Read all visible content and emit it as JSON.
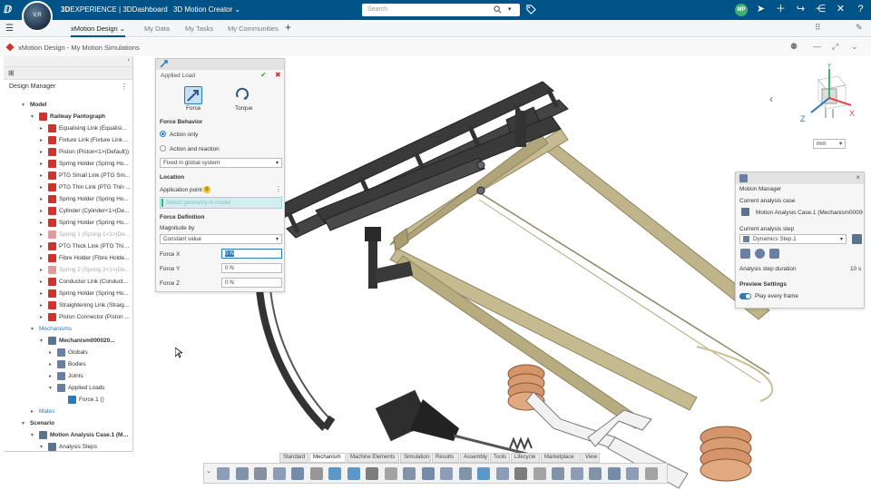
{
  "topbar": {
    "brand": "3DEXPERIENCE | 3DDashboard",
    "brand_prefix": "3D",
    "brand_rest": "EXPERIENCE | 3DDashboard",
    "app_name": "3D Motion Creator",
    "compass_text": "V,R",
    "search_placeholder": "Search",
    "user_initials": "MP"
  },
  "tabbar": {
    "tabs": [
      {
        "label": "xMotion Design"
      },
      {
        "label": "My Data"
      },
      {
        "label": "My Tasks"
      },
      {
        "label": "My Communities"
      }
    ],
    "add_tab": "+"
  },
  "breadcrumb": {
    "text": "xMotion Design - My Motion Simulations"
  },
  "design_manager": {
    "title": "Design Manager",
    "tree": [
      {
        "label": "Model",
        "level": 0,
        "style": "bold",
        "arrow": "▾"
      },
      {
        "label": "Railway Pantograph",
        "level": 1,
        "style": "bold",
        "arrow": "▾",
        "color": "#d4312d"
      },
      {
        "label": "Equalising Link (Equalisi...",
        "level": 2,
        "arrow": "▸",
        "color": "#d4312d"
      },
      {
        "label": "Fixture Link (Fixture Link<...",
        "level": 2,
        "arrow": "▸",
        "color": "#d4312d"
      },
      {
        "label": "Piston (Piston<1>(Default))",
        "level": 2,
        "arrow": "▸",
        "color": "#d4312d"
      },
      {
        "label": "Spring Holder (Spring Ho...",
        "level": 2,
        "arrow": "▸",
        "color": "#d4312d"
      },
      {
        "label": "PTG Small Link (PTG Sm...",
        "level": 2,
        "arrow": "▸",
        "color": "#d4312d"
      },
      {
        "label": "PTG Thin Link (PTG Thin ...",
        "level": 2,
        "arrow": "▸",
        "color": "#d4312d"
      },
      {
        "label": "Spring Holder (Spring Ho...",
        "level": 2,
        "arrow": "▸",
        "color": "#d4312d"
      },
      {
        "label": "Cylinder (Cylinder<1>(De...",
        "level": 2,
        "arrow": "▸",
        "color": "#d4312d"
      },
      {
        "label": "Spring Holder (Spring Ho...",
        "level": 2,
        "arrow": "▸",
        "color": "#d4312d"
      },
      {
        "label": "Spring 1 (Spring 1<1>(De...",
        "level": 2,
        "arrow": "▸",
        "color": "#e59a97",
        "style": "gray"
      },
      {
        "label": "PTG Thick Link (PTG Thic...",
        "level": 2,
        "arrow": "▸",
        "color": "#d4312d"
      },
      {
        "label": "Fibre Holder (Fibre Holde...",
        "level": 2,
        "arrow": "▸",
        "color": "#d4312d"
      },
      {
        "label": "Spring 2 (Spring 2<1>(De...",
        "level": 2,
        "arrow": "▸",
        "color": "#e59a97",
        "style": "gray"
      },
      {
        "label": "Conductor Link (Conduct...",
        "level": 2,
        "arrow": "▸",
        "color": "#d4312d"
      },
      {
        "label": "Spring Holder (Spring Ho...",
        "level": 2,
        "arrow": "▸",
        "color": "#d4312d"
      },
      {
        "label": "Straightening Link (Straig...",
        "level": 2,
        "arrow": "▸",
        "color": "#d4312d"
      },
      {
        "label": "Piston Connector (Piston ...",
        "level": 2,
        "arrow": "▸",
        "color": "#d4312d"
      },
      {
        "label": "Mechanisms",
        "level": 1,
        "arrow": "▾",
        "style": "blue"
      },
      {
        "label": "Mechanism000020...",
        "level": 2,
        "arrow": "▾",
        "style": "bold",
        "color": "#5a7390"
      },
      {
        "label": "Globals",
        "level": 3,
        "arrow": "▸",
        "color": "#6b7fa3"
      },
      {
        "label": "Bodies",
        "level": 3,
        "arrow": "▸",
        "color": "#6b7fa3"
      },
      {
        "label": "Joints",
        "level": 3,
        "arrow": "▸",
        "color": "#6b7fa3"
      },
      {
        "label": "Applied Loads",
        "level": 3,
        "arrow": "▾",
        "color": "#6b7fa3"
      },
      {
        "label": "Force.1 ()",
        "level": 4,
        "arrow": "",
        "color": "#2a7ab8"
      },
      {
        "label": "Mates",
        "level": 1,
        "arrow": "▸",
        "style": "blue"
      },
      {
        "label": "Scenario",
        "level": 0,
        "arrow": "▾",
        "style": "bold"
      },
      {
        "label": "Motion Analysis Case.1 (Mo...",
        "level": 1,
        "arrow": "▾",
        "style": "bold",
        "color": "#5a7390"
      },
      {
        "label": "Analysis Steps",
        "level": 2,
        "arrow": "▾",
        "color": "#5a7390"
      }
    ]
  },
  "applied_load": {
    "title": "Applied Load",
    "force_label": "Force",
    "torque_label": "Torque",
    "force_behavior_title": "Force Behavior",
    "radio_action_only": "Action only",
    "radio_action_reaction": "Action and reaction",
    "system_option": "Fixed in global system",
    "location_title": "Location",
    "application_point_label": "Application point",
    "application_point_badge": "0",
    "geometry_placeholder": "Select geometry in model",
    "force_definition_title": "Force Definition",
    "magnitude_label": "Magnitude by",
    "magnitude_option": "Constant value",
    "force_x_label": "Force X",
    "force_x_value": "0 N",
    "force_y_label": "Force Y",
    "force_y_value": "0 N",
    "force_z_label": "Force Z",
    "force_z_value": "0 N"
  },
  "motion_manager": {
    "title": "Motion Manager",
    "current_case_label": "Current analysis case",
    "current_case_value": "Motion Analysis Case.1 (Mechanism00000",
    "current_step_label": "Current analysis step",
    "current_step_value": "Dynamics Step.1",
    "duration_label": "Analysis step duration",
    "duration_value": "10 s",
    "preview_title": "Preview Settings",
    "play_every_frame": "Play every frame"
  },
  "view": {
    "unit": "mm",
    "axis_y": "Y",
    "axis_x": "X",
    "axis_z": "Z"
  },
  "bottom_tabs": [
    "Standard",
    "Mechanism",
    "Machine Elements",
    "Simulation",
    "Results",
    "Assembly",
    "Tools",
    "Lifecycle",
    "Marketplace",
    "View"
  ],
  "colors": {
    "brand_bar": "#005386",
    "accent_blue": "#2a7ab8",
    "part_red": "#d4312d",
    "rail_dark": "#3a3a3a",
    "rod_tan": "#bfb48a",
    "spring_copper": "#d4956a"
  }
}
